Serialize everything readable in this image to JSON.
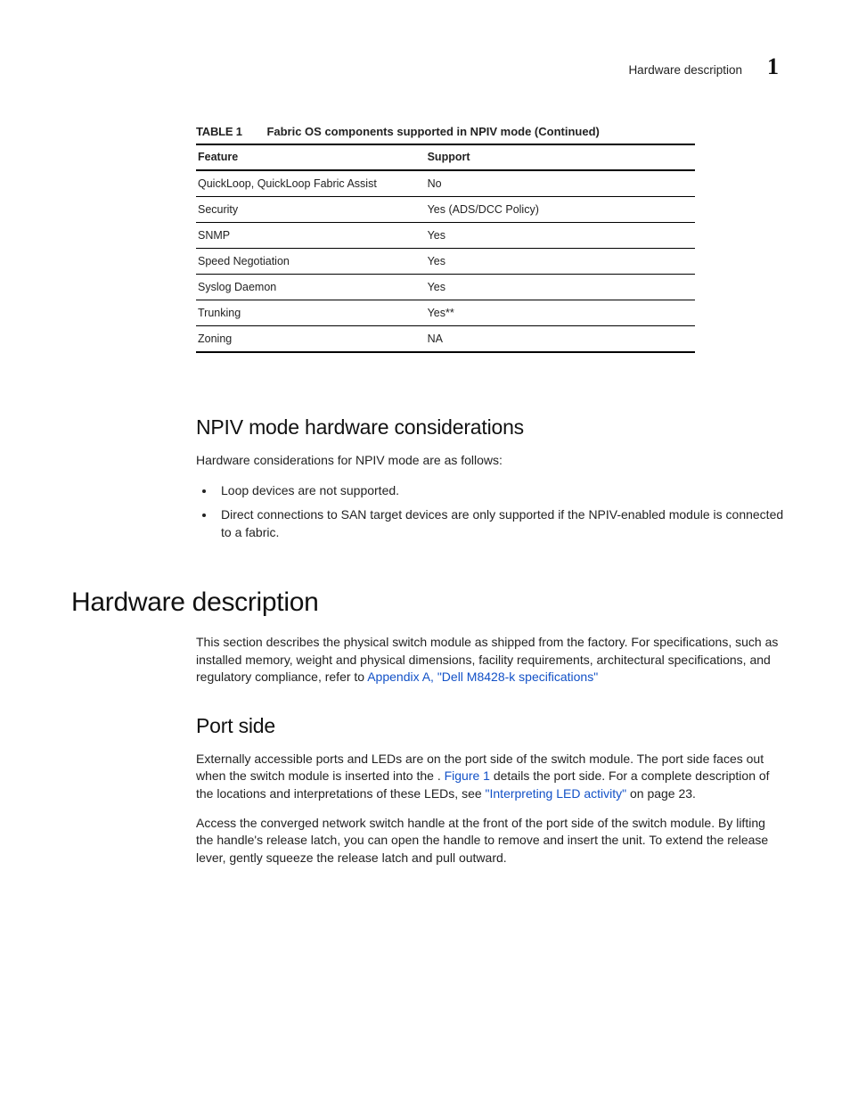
{
  "running_head": {
    "text": "Hardware description",
    "number": "1"
  },
  "table": {
    "label": "TABLE 1",
    "title": "Fabric OS components supported in NPIV mode (Continued)",
    "headers": [
      "Feature",
      "Support"
    ],
    "rows": [
      {
        "feature": "QuickLoop, QuickLoop Fabric Assist",
        "support": "No"
      },
      {
        "feature": "Security",
        "support": "Yes (ADS/DCC Policy)"
      },
      {
        "feature": "SNMP",
        "support": "Yes"
      },
      {
        "feature": "Speed Negotiation",
        "support": "Yes"
      },
      {
        "feature": "Syslog Daemon",
        "support": "Yes"
      },
      {
        "feature": "Trunking",
        "support": "Yes**"
      },
      {
        "feature": "Zoning",
        "support": "NA"
      }
    ]
  },
  "section_npiv": {
    "heading": "NPIV mode hardware considerations",
    "intro": "Hardware considerations for NPIV mode are as follows:",
    "bullets": [
      "Loop devices are not supported.",
      "Direct connections to SAN target devices are only supported if the NPIV-enabled module is connected to a fabric."
    ]
  },
  "chapter_hw": {
    "heading": "Hardware description",
    "para_pre": "This section describes the physical switch module as shipped from the factory. For specifications, such as installed memory, weight and physical dimensions, facility requirements, architectural specifications, and regulatory compliance, refer to ",
    "para_link": "Appendix A, \"Dell M8428-k specifications\""
  },
  "section_port": {
    "heading": "Port side",
    "p1_a": "Externally accessible ports and LEDs are on the port side of the switch module. The port side faces out when the switch module is inserted into the ",
    "p1_sep": ". ",
    "p1_link": "Figure 1",
    "p1_b": " details the port side. For a complete description of the locations and interpretations of these LEDs, see ",
    "p1_link2": "\"Interpreting LED activity\"",
    "p1_c": " on page 23.",
    "p2": "Access the converged network switch handle at the front of the port side of the switch module. By lifting the handle's release latch, you can open the handle to remove and insert the unit. To extend the release lever, gently squeeze the release latch and pull outward."
  }
}
